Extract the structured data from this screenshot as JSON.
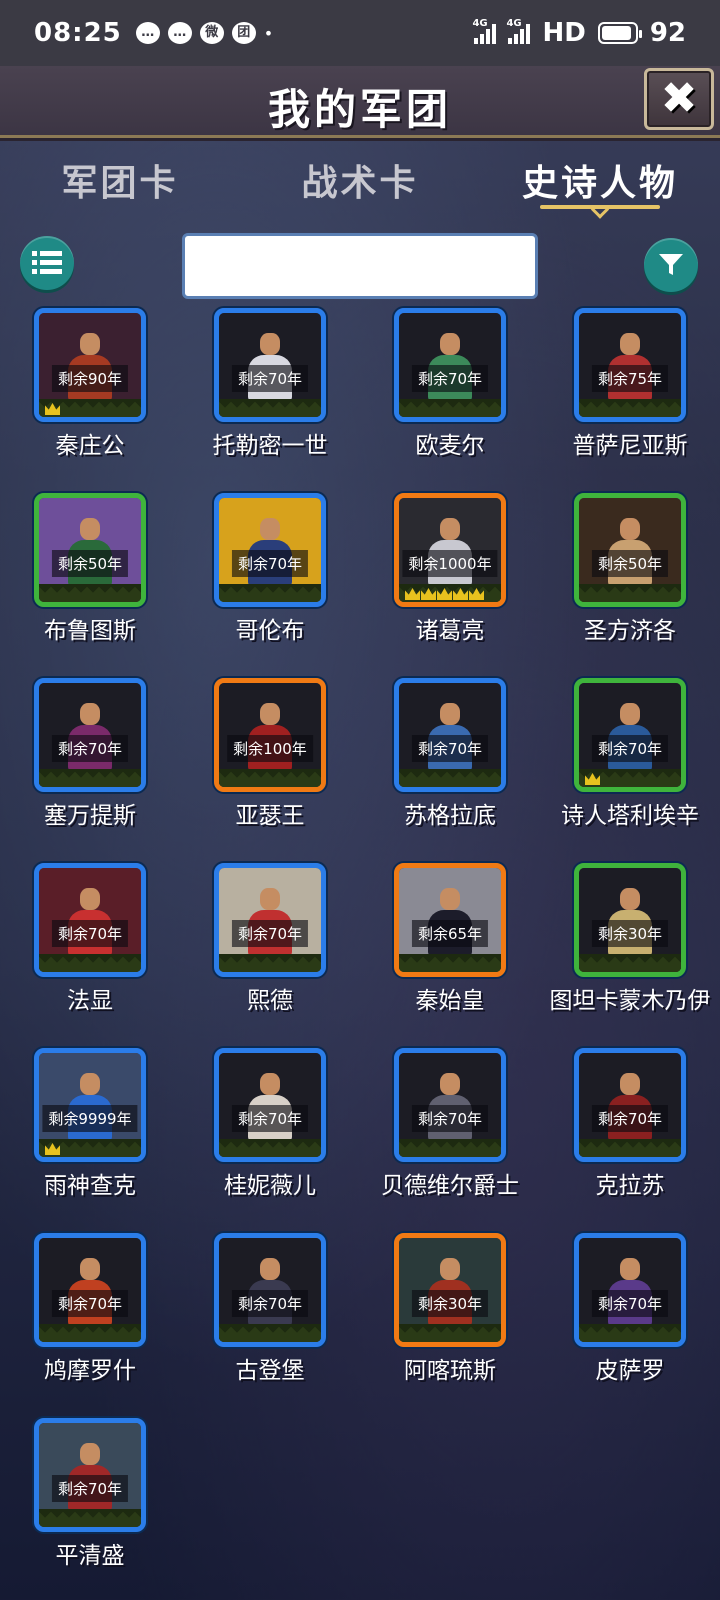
{
  "status_bar": {
    "time": "08:25",
    "notification_icons": [
      "chat-icon",
      "message-icon",
      "weibo-icon",
      "tuan-icon"
    ],
    "notification_glyphs": [
      "…",
      "…",
      "微",
      "团"
    ],
    "dot": "•",
    "signal1_label": "4G",
    "signal2_label": "4G",
    "hd": "HD",
    "battery": "92"
  },
  "header": {
    "title": "我的军团",
    "close_glyph": "✖"
  },
  "tabs": [
    {
      "label": "军团卡",
      "active": false
    },
    {
      "label": "战术卡",
      "active": false
    },
    {
      "label": "史诗人物",
      "active": true
    }
  ],
  "search": {
    "value": "",
    "placeholder": ""
  },
  "heroes": [
    {
      "name": "秦庄公",
      "remain": "剩余90年",
      "frame": "blue",
      "crowns": 1,
      "bg": "#3b2030",
      "robe": "#a63a22"
    },
    {
      "name": "托勒密一世",
      "remain": "剩余70年",
      "frame": "blue",
      "crowns": 0,
      "bg": "#1c1c24",
      "robe": "#d8d8e0"
    },
    {
      "name": "欧麦尔",
      "remain": "剩余70年",
      "frame": "blue",
      "crowns": 0,
      "bg": "#1c1c24",
      "robe": "#3c8a5a"
    },
    {
      "name": "普萨尼亚斯",
      "remain": "剩余75年",
      "frame": "blue",
      "crowns": 0,
      "bg": "#1c1c24",
      "robe": "#b03030"
    },
    {
      "name": "布鲁图斯",
      "remain": "剩余50年",
      "frame": "green",
      "crowns": 0,
      "bg": "#6e4f9a",
      "robe": "#2a6a3a"
    },
    {
      "name": "哥伦布",
      "remain": "剩余70年",
      "frame": "blue",
      "crowns": 0,
      "bg": "#d7a21c",
      "robe": "#2a3e7a"
    },
    {
      "name": "诸葛亮",
      "remain": "剩余1000年",
      "frame": "orange",
      "crowns": 5,
      "bg": "#2a2a30",
      "robe": "#c8c8d0"
    },
    {
      "name": "圣方济各",
      "remain": "剩余50年",
      "frame": "green",
      "crowns": 0,
      "bg": "#3a2a1e",
      "robe": "#c8a070"
    },
    {
      "name": "塞万提斯",
      "remain": "剩余70年",
      "frame": "blue",
      "crowns": 0,
      "bg": "#1c1c24",
      "robe": "#7a2a6a"
    },
    {
      "name": "亚瑟王",
      "remain": "剩余100年",
      "frame": "orange",
      "crowns": 0,
      "bg": "#1c1c24",
      "robe": "#a02020"
    },
    {
      "name": "苏格拉底",
      "remain": "剩余70年",
      "frame": "blue",
      "crowns": 0,
      "bg": "#1c1c24",
      "robe": "#3a6ab0"
    },
    {
      "name": "诗人塔利埃辛",
      "remain": "剩余70年",
      "frame": "green",
      "crowns": 1,
      "bg": "#1c1c24",
      "robe": "#2a5a9a"
    },
    {
      "name": "法显",
      "remain": "剩余70年",
      "frame": "blue",
      "crowns": 0,
      "bg": "#5a1e28",
      "robe": "#c83030"
    },
    {
      "name": "熙德",
      "remain": "剩余70年",
      "frame": "blue",
      "crowns": 0,
      "bg": "#b8b0a0",
      "robe": "#c03030"
    },
    {
      "name": "秦始皇",
      "remain": "剩余65年",
      "frame": "orange",
      "crowns": 0,
      "bg": "#8a8a94",
      "robe": "#1c1c2a"
    },
    {
      "name": "图坦卡蒙木乃伊",
      "remain": "剩余30年",
      "frame": "green",
      "crowns": 0,
      "bg": "#1c1c24",
      "robe": "#c8b070"
    },
    {
      "name": "雨神查克",
      "remain": "剩余9999年",
      "frame": "blue",
      "crowns": 1,
      "bg": "#3a4a6a",
      "robe": "#2a6ad0"
    },
    {
      "name": "桂妮薇儿",
      "remain": "剩余70年",
      "frame": "blue",
      "crowns": 0,
      "bg": "#1c1c24",
      "robe": "#d8d0c8"
    },
    {
      "name": "贝德维尔爵士",
      "remain": "剩余70年",
      "frame": "blue",
      "crowns": 0,
      "bg": "#1c1c24",
      "robe": "#606070"
    },
    {
      "name": "克拉苏",
      "remain": "剩余70年",
      "frame": "blue",
      "crowns": 0,
      "bg": "#1c1c24",
      "robe": "#8a2020"
    },
    {
      "name": "鸠摩罗什",
      "remain": "剩余70年",
      "frame": "blue",
      "crowns": 0,
      "bg": "#1c1c24",
      "robe": "#c04020"
    },
    {
      "name": "古登堡",
      "remain": "剩余70年",
      "frame": "blue",
      "crowns": 0,
      "bg": "#1c1c24",
      "robe": "#3a3a50"
    },
    {
      "name": "阿喀琉斯",
      "remain": "剩余30年",
      "frame": "orange",
      "crowns": 0,
      "bg": "#2a3a3a",
      "robe": "#a03020"
    },
    {
      "name": "皮萨罗",
      "remain": "剩余70年",
      "frame": "blue",
      "crowns": 0,
      "bg": "#1c1c24",
      "robe": "#5a3a8a"
    },
    {
      "name": "平清盛",
      "remain": "剩余70年",
      "frame": "blue",
      "crowns": 0,
      "bg": "#3a4a5a",
      "robe": "#a02828"
    }
  ]
}
